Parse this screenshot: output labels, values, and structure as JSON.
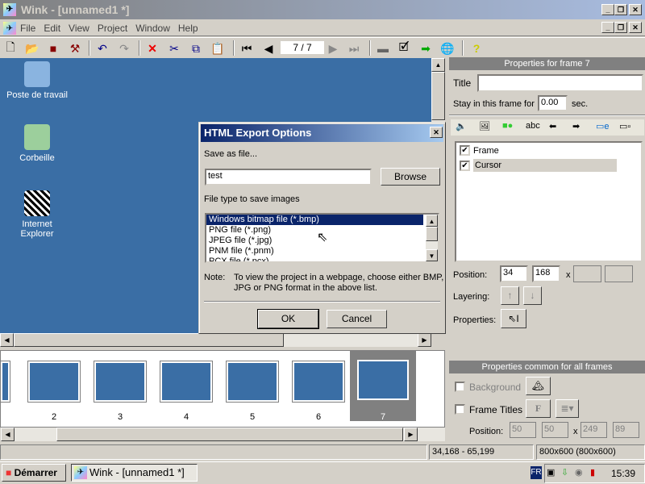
{
  "window": {
    "title": "Wink - [unnamed1 *]"
  },
  "menu": [
    "File",
    "Edit",
    "View",
    "Project",
    "Window",
    "Help"
  ],
  "toolbar": {
    "frame_counter": "7 / 7",
    "icons": [
      "new-icon",
      "open-icon",
      "save-icon",
      "build-icon",
      "undo-icon",
      "redo-icon",
      "delete-icon",
      "cut-icon",
      "copy-icon",
      "paste-icon",
      "first-frame-icon",
      "prev-frame-icon",
      "next-frame-icon",
      "last-frame-icon",
      "screen-icon",
      "document-check-icon",
      "arrow-right-icon",
      "globe-icon",
      "help-icon"
    ]
  },
  "desktop": {
    "icons": [
      "Poste de travail",
      "Corbeille",
      "Internet Explorer"
    ]
  },
  "dialog": {
    "title": "HTML Export Options",
    "save_label": "Save as file...",
    "filename": "test",
    "browse": "Browse",
    "filetype_label": "File type to save images",
    "filetypes": [
      "Windows bitmap file (*.bmp)",
      "PNG file (*.png)",
      "JPEG file (*.jpg)",
      "PNM file (*.pnm)",
      "PCX file (*.pcx)"
    ],
    "selected": "Windows bitmap file (*.bmp)",
    "note_label": "Note:",
    "note": "To view the project in a webpage, choose either BMP, JPG or PNG format in the above list.",
    "ok": "OK",
    "cancel": "Cancel"
  },
  "frames": {
    "labels": [
      "2",
      "3",
      "4",
      "5",
      "6",
      "7"
    ],
    "selected": "7"
  },
  "props": {
    "header": "Properties for frame 7",
    "title_label": "Title",
    "title_value": "",
    "stay_label": "Stay in this frame for",
    "stay_value": "0.00",
    "sec": "sec.",
    "items": [
      {
        "label": "Frame",
        "checked": true
      },
      {
        "label": "Cursor",
        "checked": true
      }
    ],
    "position_label": "Position:",
    "pos_x": "34",
    "pos_y": "168",
    "x": "x",
    "layering_label": "Layering:",
    "properties_label": "Properties:"
  },
  "common": {
    "header": "Properties common for all frames",
    "background": "Background",
    "frame_titles": "Frame Titles",
    "position_label": "Position:",
    "pos": [
      "50",
      "50",
      "249",
      "89"
    ],
    "x": "x"
  },
  "status": {
    "coords": "34,168 - 65,199",
    "size": "800x600 (800x600)"
  },
  "taskbar": {
    "start": "Démarrer",
    "task": "Wink - [unnamed1 *]",
    "lang": "FR",
    "clock": "15:39"
  }
}
